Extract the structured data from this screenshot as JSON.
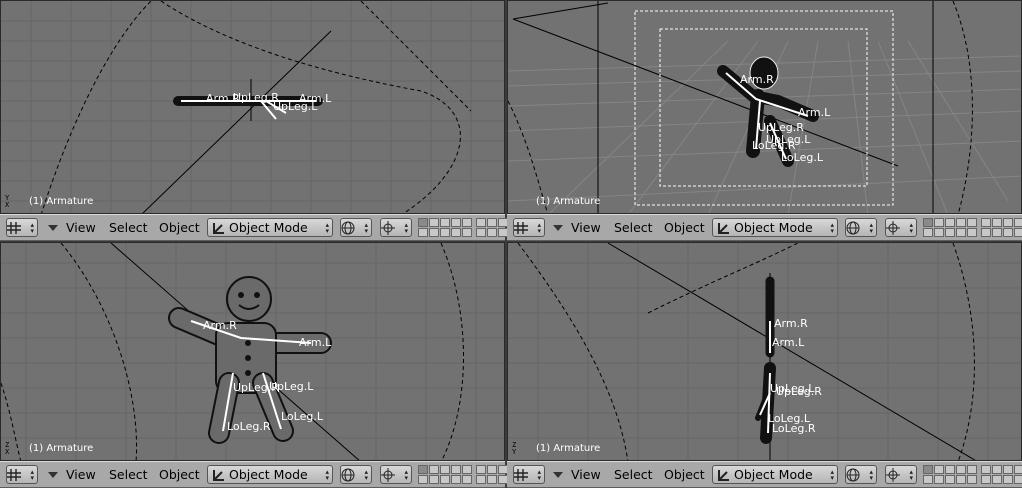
{
  "viewports": [
    {
      "id": "top-left",
      "label": "(1) Armature",
      "axes": [
        "Y",
        "X"
      ],
      "bones": [
        {
          "text": "Arm.R",
          "pos": "a"
        },
        {
          "text": "Arm.L",
          "pos": "b"
        },
        {
          "text": "UpLeg.R",
          "pos": "c"
        },
        {
          "text": "UpLeg.L",
          "pos": "d"
        }
      ]
    },
    {
      "id": "top-right",
      "label": "(1) Armature",
      "axes": [],
      "bones": [
        {
          "text": "Arm.R"
        },
        {
          "text": "Arm.L"
        },
        {
          "text": "UpLeg.R"
        },
        {
          "text": "UpLeg.L"
        },
        {
          "text": "LoLeg.R"
        },
        {
          "text": "LoLeg.L"
        }
      ]
    },
    {
      "id": "bottom-left",
      "label": "(1) Armature",
      "axes": [
        "Z",
        "X"
      ],
      "bones": [
        {
          "text": "Arm.R"
        },
        {
          "text": "Arm.L"
        },
        {
          "text": "UpLeg.R"
        },
        {
          "text": "UpLeg.L"
        },
        {
          "text": "LoLeg.R"
        },
        {
          "text": "LoLeg.L"
        }
      ]
    },
    {
      "id": "bottom-right",
      "label": "(1) Armature",
      "axes": [
        "Z",
        "Y"
      ],
      "bones": [
        {
          "text": "Arm.R"
        },
        {
          "text": "Arm.L"
        },
        {
          "text": "UpLeg.L"
        },
        {
          "text": "UpLeg.R"
        },
        {
          "text": "LoLeg.L"
        },
        {
          "text": "LoLeg.R"
        }
      ]
    }
  ],
  "header": {
    "view_label": "View",
    "select_label": "Select",
    "object_label": "Object",
    "mode_label": "Object Mode",
    "editor_icon": "grid-icon",
    "mode_icon": "armature-pose-icon",
    "shading_icon": "wireframe-sphere-icon",
    "pivot_icon": "crosshair-pivot-icon"
  },
  "colors": {
    "viewport_bg": "#727272",
    "header_bg": "#a8a8a8",
    "label_text": "#ffffff",
    "mesh": "#000000",
    "bone": "#ffffff"
  }
}
